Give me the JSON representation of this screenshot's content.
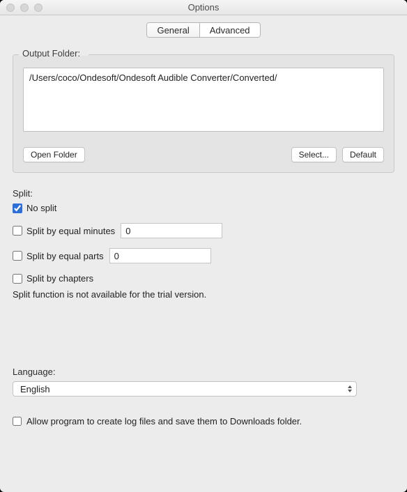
{
  "window": {
    "title": "Options"
  },
  "tabs": {
    "general": "General",
    "advanced": "Advanced",
    "active": "advanced"
  },
  "output": {
    "label": "Output Folder:",
    "path": "/Users/coco/Ondesoft/Ondesoft Audible Converter/Converted/",
    "open_btn": "Open Folder",
    "select_btn": "Select...",
    "default_btn": "Default"
  },
  "split": {
    "label": "Split:",
    "no_split": "No split",
    "no_split_checked": true,
    "by_minutes": "Split by equal minutes",
    "by_minutes_checked": false,
    "minutes_value": "0",
    "by_parts": "Split by equal parts",
    "by_parts_checked": false,
    "parts_value": "0",
    "by_chapters": "Split by chapters",
    "by_chapters_checked": false,
    "note": "Split function is not available for the trial version."
  },
  "language": {
    "label": "Language:",
    "value": "English"
  },
  "log": {
    "label": "Allow program to create log files and save them to Downloads folder.",
    "checked": false
  }
}
